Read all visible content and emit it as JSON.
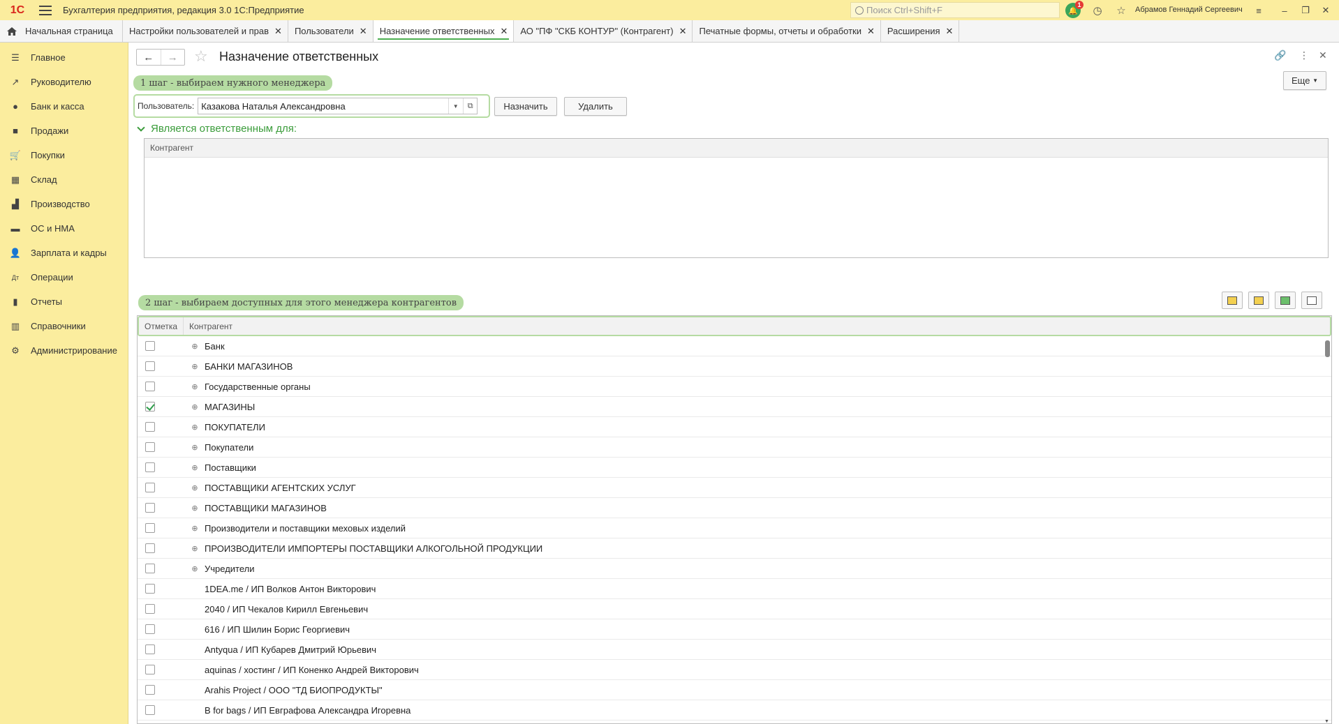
{
  "titlebar": {
    "logo": "1С",
    "app_title": "Бухгалтерия предприятия, редакция 3.0 1С:Предприятие",
    "search_placeholder": "Поиск Ctrl+Shift+F",
    "notifications_count": "1",
    "user_name": "Абрамов Геннадий Сергеевич"
  },
  "tabs": {
    "home": "Начальная страница",
    "items": [
      {
        "label": "Настройки пользователей и прав"
      },
      {
        "label": "Пользователи"
      },
      {
        "label": "Назначение ответственных"
      },
      {
        "label": "АО \"ПФ \"СКБ КОНТУР\" (Контрагент)"
      },
      {
        "label": "Печатные формы, отчеты и обработки"
      },
      {
        "label": "Расширения"
      }
    ]
  },
  "sidebar": {
    "items": [
      {
        "label": "Главное",
        "icon": "menu-icon"
      },
      {
        "label": "Руководителю",
        "icon": "trend-icon"
      },
      {
        "label": "Банк и касса",
        "icon": "coin-icon"
      },
      {
        "label": "Продажи",
        "icon": "bag-icon"
      },
      {
        "label": "Покупки",
        "icon": "cart-icon"
      },
      {
        "label": "Склад",
        "icon": "grid-icon"
      },
      {
        "label": "Производство",
        "icon": "factory-icon"
      },
      {
        "label": "ОС и НМА",
        "icon": "truck-icon"
      },
      {
        "label": "Зарплата и кадры",
        "icon": "person-icon"
      },
      {
        "label": "Операции",
        "icon": "operations-icon"
      },
      {
        "label": "Отчеты",
        "icon": "bar-chart-icon"
      },
      {
        "label": "Справочники",
        "icon": "books-icon"
      },
      {
        "label": "Администрирование",
        "icon": "gear-icon"
      }
    ]
  },
  "form": {
    "title": "Назначение ответственных",
    "more_label": "Еще",
    "step1_hint": "1 шаг - выбираем нужного менеджера",
    "user_label": "Пользователь:",
    "user_value": "Казакова Наталья Александровна",
    "assign_label": "Назначить",
    "delete_label": "Удалить",
    "group_title": "Является ответственным для:",
    "table1_header": "Контрагент",
    "step2_hint": "2 шаг - выбираем доступных для этого менеджера контрагентов",
    "table2": {
      "col_mark": "Отметка",
      "col_counterparty": "Контрагент",
      "rows": [
        {
          "name": "Банк",
          "checked": false,
          "group": true
        },
        {
          "name": "БАНКИ МАГАЗИНОВ",
          "checked": false,
          "group": true
        },
        {
          "name": "Государственные органы",
          "checked": false,
          "group": true
        },
        {
          "name": "МАГАЗИНЫ",
          "checked": true,
          "group": true
        },
        {
          "name": "ПОКУПАТЕЛИ",
          "checked": false,
          "group": true
        },
        {
          "name": "Покупатели",
          "checked": false,
          "group": true
        },
        {
          "name": "Поставщики",
          "checked": false,
          "group": true
        },
        {
          "name": "ПОСТАВЩИКИ АГЕНТСКИХ УСЛУГ",
          "checked": false,
          "group": true
        },
        {
          "name": "ПОСТАВЩИКИ МАГАЗИНОВ",
          "checked": false,
          "group": true
        },
        {
          "name": "Производители и поставщики меховых изделий",
          "checked": false,
          "group": true
        },
        {
          "name": "ПРОИЗВОДИТЕЛИ ИМПОРТЕРЫ ПОСТАВЩИКИ АЛКОГОЛЬНОЙ ПРОДУКЦИИ",
          "checked": false,
          "group": true
        },
        {
          "name": "Учредители",
          "checked": false,
          "group": true
        },
        {
          "name": "1DEA.me / ИП Волков Антон Викторович",
          "checked": false,
          "group": false
        },
        {
          "name": "2040 / ИП Чекалов Кирилл Евгеньевич",
          "checked": false,
          "group": false
        },
        {
          "name": "616 / ИП Шилин Борис Георгиевич",
          "checked": false,
          "group": false
        },
        {
          "name": "Antyqua / ИП Кубарев Дмитрий Юрьевич",
          "checked": false,
          "group": false
        },
        {
          "name": "aquinas / хостинг / ИП Коненко Андрей Викторович",
          "checked": false,
          "group": false
        },
        {
          "name": "Arahis Project / ООО \"ТД БИОПРОДУКТЫ\"",
          "checked": false,
          "group": false
        },
        {
          "name": "B for bags / ИП Евграфова Александра Игоревна",
          "checked": false,
          "group": false
        }
      ]
    }
  }
}
